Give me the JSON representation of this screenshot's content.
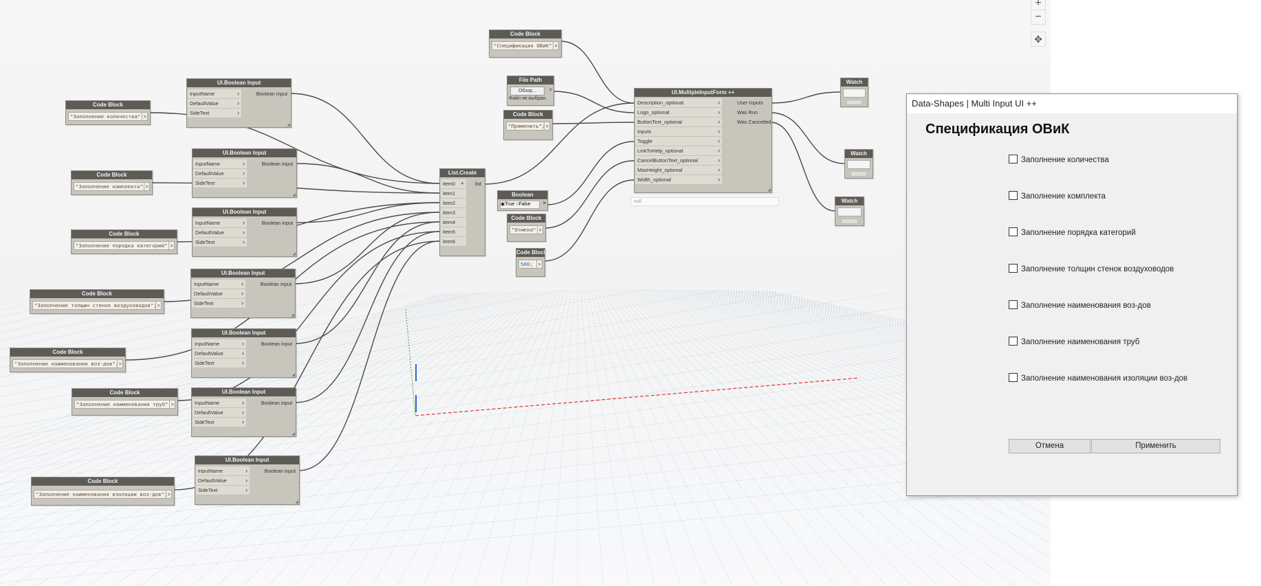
{
  "canvas": {
    "zoom_in": "+",
    "zoom_out": "−",
    "pan": "✥"
  },
  "nodes": {
    "code_blocks": [
      {
        "title": "Code Block",
        "code": "\"Заполнение количества\";"
      },
      {
        "title": "Code Block",
        "code": "\"Заполнение комплекта\";"
      },
      {
        "title": "Code Block",
        "code": "\"Заполнение порядка категорий\";"
      },
      {
        "title": "Code Block",
        "code": "\"Заполнение толщин стенок воздуховодов\";"
      },
      {
        "title": "Code Block",
        "code": "\"Заполнение наименования воз-дов\";"
      },
      {
        "title": "Code Block",
        "code": "\"Заполнение наименования труб\";"
      },
      {
        "title": "Code Block",
        "code": "\"Заполнение наименования изоляции воз-дов\";"
      }
    ],
    "boolean_inputs": {
      "title": "UI.Boolean Input",
      "inputs": [
        "InputName",
        "DefaultValue",
        "SideText"
      ],
      "output": "Boolean input"
    },
    "list_create": {
      "title": "List.Create",
      "inputs": [
        "item0",
        "item1",
        "item2",
        "item3",
        "item4",
        "item5",
        "item6"
      ],
      "output": "list"
    },
    "title_code": {
      "title": "Code Block",
      "code": "\"Спецификация ОВиК\";"
    },
    "file_path": {
      "title": "File Path",
      "button": "Обзор...",
      "value": "Файл не выбран."
    },
    "apply_code": {
      "title": "Code Block",
      "code": "\"Применить\";"
    },
    "boolean": {
      "title": "Boolean",
      "true_label": "True",
      "false_label": "False"
    },
    "cancel_code": {
      "title": "Code Block",
      "code": "\"Отмена\";"
    },
    "number_code": {
      "title": "Code Block",
      "code": "500;"
    },
    "form": {
      "title": "UI.MultipleInputForm ++",
      "inputs": [
        "Description_optional",
        "Logo_optional",
        "ButtonText_optional",
        "Inputs",
        "Toggle",
        "LinkToHelp_optional",
        "CancelButtonText_optional",
        "MaxHeight_optional",
        "Width_optional"
      ],
      "outputs": [
        "User Inputs",
        "Was Run",
        "Was Cancelled"
      ],
      "preview": "null"
    },
    "watch_title": "Watch"
  },
  "dialog": {
    "window_title": "Data-Shapes | Multi Input UI ++",
    "heading": "Спецификация ОВиК",
    "checkboxes": [
      "Заполнение количества",
      "Заполнение комплекта",
      "Заполнение порядка категорий",
      "Заполнение толщин стенок воздуховодов",
      "Заполнение наименования воз-дов",
      "Заполнение наименования труб",
      "Заполнение наименования изоляции воз-дов"
    ],
    "cancel_button": "Отмена",
    "apply_button": "Применить"
  }
}
